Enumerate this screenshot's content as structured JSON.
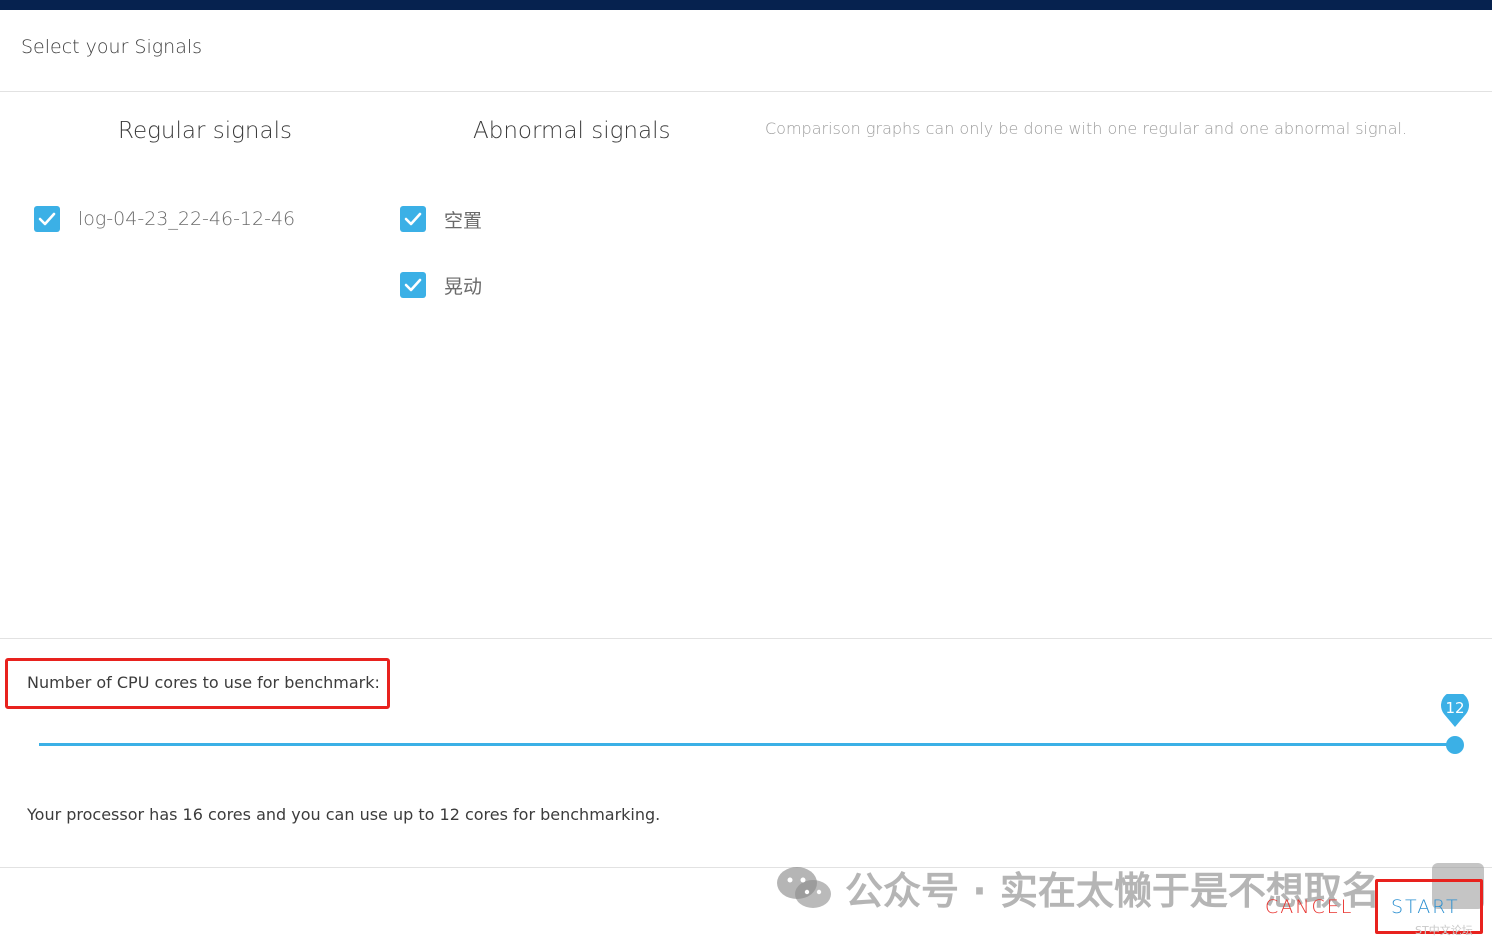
{
  "dialog": {
    "title": "Select your Signals"
  },
  "columns": {
    "regular_header": "Regular signals",
    "abnormal_header": "Abnormal signals",
    "hint": "Comparison graphs can only be done with one regular and one abnormal signal."
  },
  "regular_signals": [
    {
      "label": "log-04-23_22-46-12-46",
      "checked": true
    }
  ],
  "abnormal_signals": [
    {
      "label": "空置",
      "checked": true
    },
    {
      "label": "晃动",
      "checked": true
    }
  ],
  "cpu": {
    "label": "Number of CPU cores to use for benchmark:",
    "slider_value": "12",
    "slider_fraction": 1.0,
    "info": "Your processor has 16 cores and you can use up to 12 cores for benchmarking."
  },
  "buttons": {
    "cancel": "CANCEL",
    "start": "START"
  },
  "watermark": {
    "text": "公众号 · 实在太懒于是不想取名",
    "small": "ST中文论坛"
  },
  "colors": {
    "accent": "#3bb0e6",
    "cancel": "#e8322e",
    "highlight_box": "#e8221e",
    "topbar": "#06224f"
  }
}
